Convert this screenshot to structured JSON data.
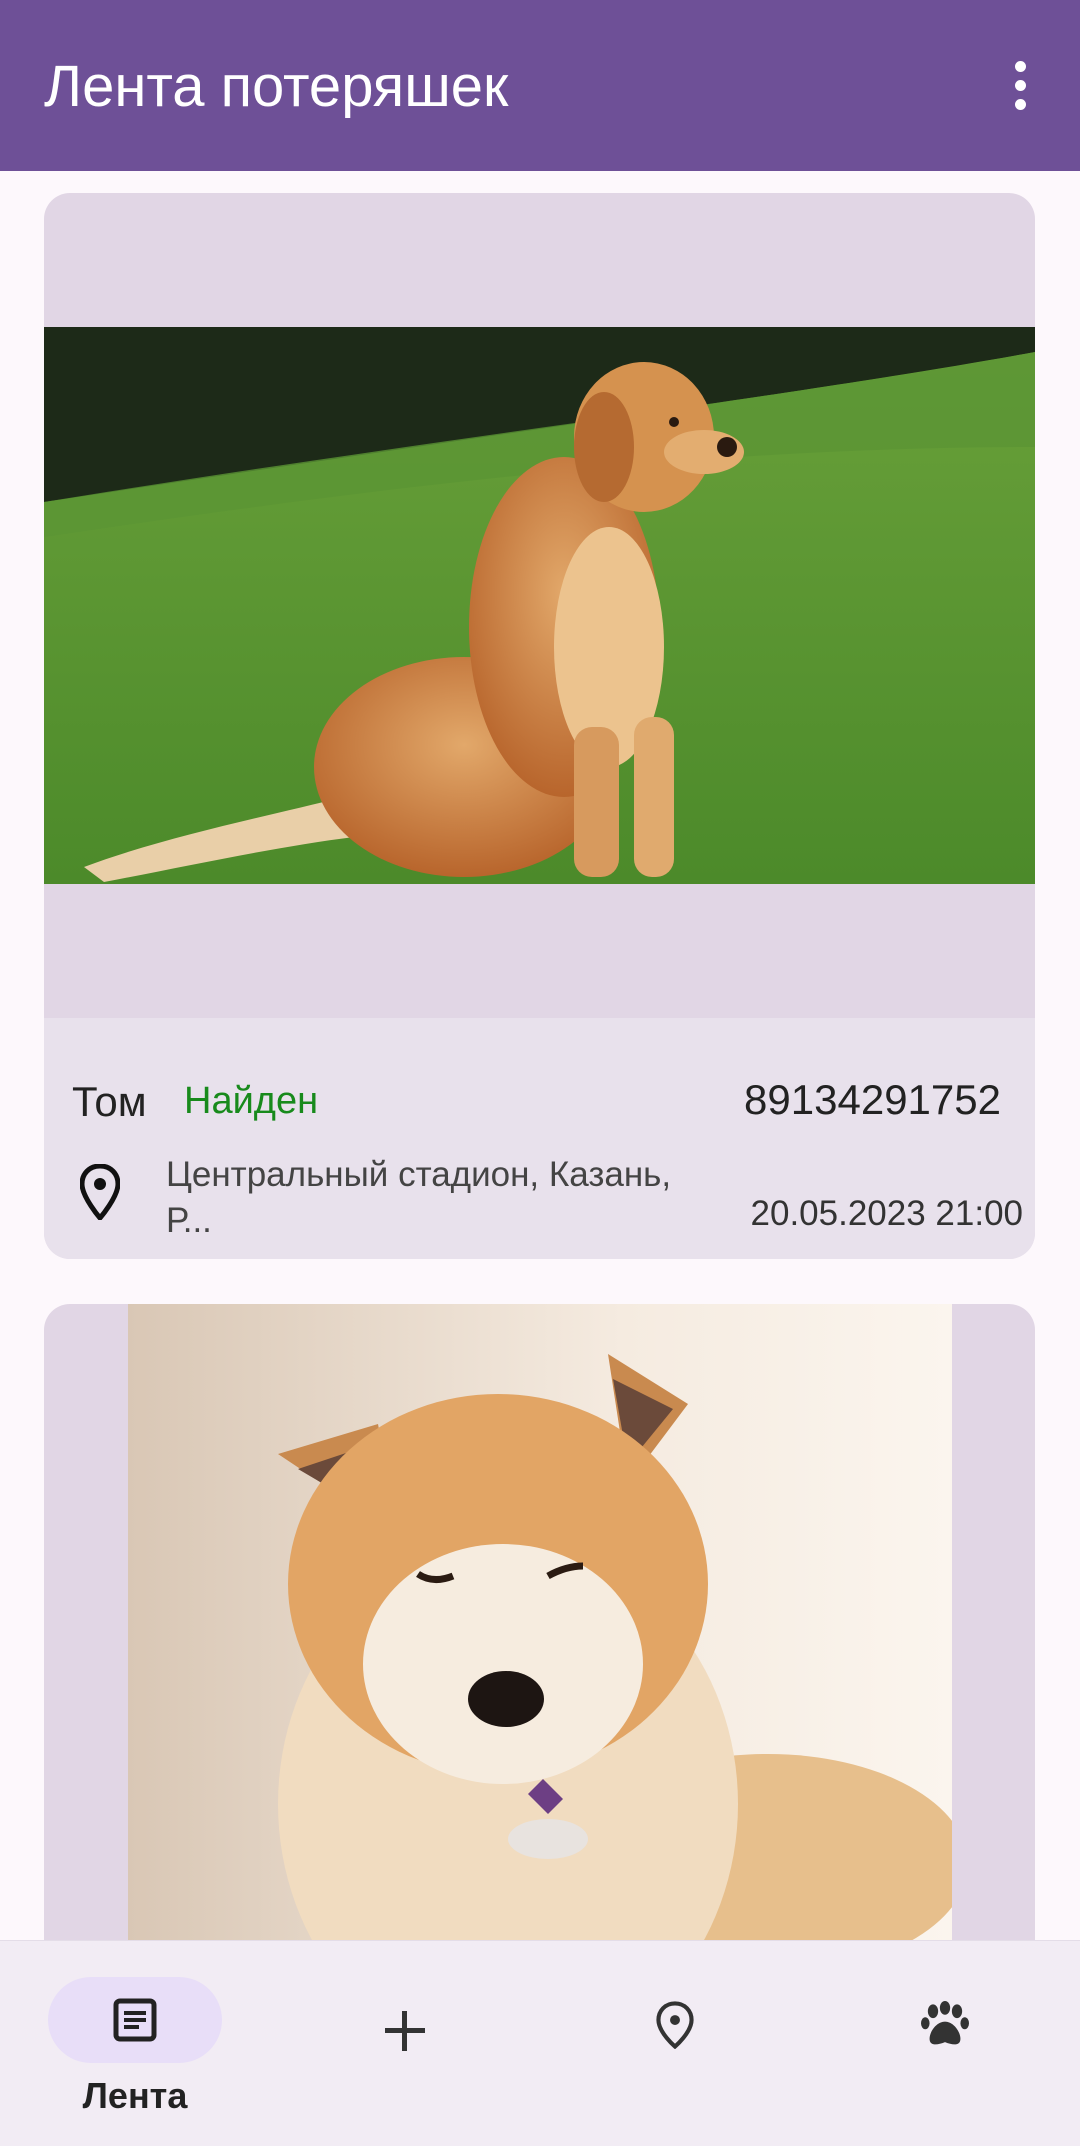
{
  "appbar": {
    "title": "Лента потеряшек",
    "menu_icon": "more-vert-icon"
  },
  "posts": [
    {
      "name": "Том",
      "status": "Найден",
      "phone": "89134291752",
      "address": "Центральный стадион, Казань, Р...",
      "date": "20.05.2023 21:00",
      "photo": "golden-retriever-on-grass"
    },
    {
      "photo": "akita-dog-lying"
    }
  ],
  "bottom_nav": [
    {
      "label": "Лента",
      "icon": "feed-icon",
      "active": true
    },
    {
      "label": "",
      "icon": "add-icon",
      "active": false
    },
    {
      "label": "",
      "icon": "map-pin-icon",
      "active": false
    },
    {
      "label": "",
      "icon": "paw-icon",
      "active": false
    }
  ],
  "colors": {
    "appbar": "#6e5097",
    "status_found": "#188a1c",
    "card_bg": "#e1d6e5",
    "nav_active_pill": "#e8def8"
  }
}
